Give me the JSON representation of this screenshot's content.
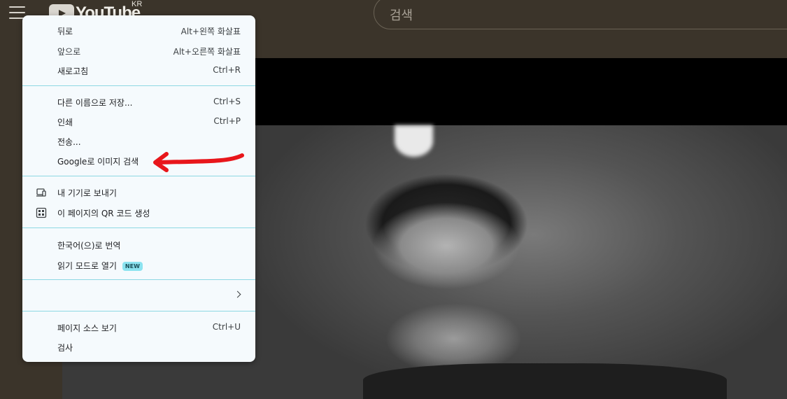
{
  "header": {
    "logo_text": "YouTube",
    "country_code": "KR",
    "search_placeholder": "검색"
  },
  "menu": {
    "groups": [
      [
        {
          "label": "뒤로",
          "shortcut": "Alt+왼쪽 화살표"
        },
        {
          "label": "앞으로",
          "shortcut": "Alt+오른쪽 화살표"
        },
        {
          "label": "새로고침",
          "shortcut": "Ctrl+R"
        }
      ],
      [
        {
          "label": "다른 이름으로 저장...",
          "shortcut": "Ctrl+S"
        },
        {
          "label": "인쇄",
          "shortcut": "Ctrl+P"
        },
        {
          "label": "전송...",
          "shortcut": ""
        },
        {
          "label": "Google로 이미지 검색",
          "shortcut": ""
        }
      ],
      [
        {
          "label": "내 기기로 보내기",
          "icon": "device-send-icon"
        },
        {
          "label": "이 페이지의 QR 코드 생성",
          "icon": "qr-code-icon"
        }
      ],
      [
        {
          "label": "한국어(으)로 번역"
        },
        {
          "label": "읽기 모드로 열기",
          "badge": "NEW"
        }
      ],
      [
        {
          "label": "",
          "submenu": true
        }
      ],
      [
        {
          "label": "페이지 소스 보기",
          "shortcut": "Ctrl+U"
        },
        {
          "label": "검사",
          "shortcut": ""
        }
      ]
    ]
  },
  "annotation": {
    "color": "#e8161b"
  }
}
